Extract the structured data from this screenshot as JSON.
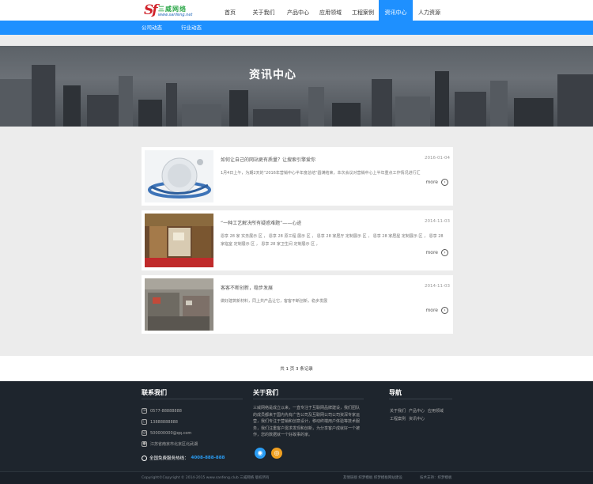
{
  "header": {
    "logo_text": "三威网络",
    "logo_mark": "Sf",
    "logo_url": "www.sanfeng.net",
    "nav": [
      "首页",
      "关于我们",
      "产品中心",
      "应用领域",
      "工程案例",
      "资讯中心",
      "人力资源"
    ],
    "active_index": 5
  },
  "subnav": [
    "公司动态",
    "行业动态"
  ],
  "banner": {
    "title": "资讯中心"
  },
  "news": [
    {
      "title": "如何让自己的网站更有质量？让搜索引擎爱你",
      "date": "2016-01-04",
      "desc": "1月4日上午，为期2天的“2016年营销中心半年度总结”圆满结束，本次会议对营销中心上半年重点工作情况进行汇",
      "more": "more"
    },
    {
      "title": "“一种工艺解决所有疑惑难题”——心迹",
      "date": "2014-11-03",
      "desc": "恩享 28 家 实务展示 区 ， 恩享 28 原工程 展示 区 ， 恩享 28 家居厅 定制展示 区 ， 恩享 28 家居屋 定制展示 区 ， 恩享 28 家临室 定制展示 区 ， 恩享 28 家卫生间 定制展示 区 ，",
      "more": "more"
    },
    {
      "title": "客客不断创新，稳步发展",
      "date": "2014-11-03",
      "desc": "做好建筑新材料，同上共产品让它，客客不断创新，稳步发展",
      "more": "more"
    }
  ],
  "pager": "共 1 页 3 条记录",
  "footer": {
    "contact_title": "联系我们",
    "phone": "0577-88888888",
    "mobile": "13888888888",
    "email": "500000000@qq.com",
    "address": "江苏省南京市北京区北武湖",
    "hotline_label": "全国免费服务热线：",
    "hotline": "4008-888-888",
    "about_title": "关于我们",
    "about_text": "三威网络是成立以来，一直专注于互联网品牌建设，我们团队的成员都来于国内先有广告公司及互联网公司公司资深专家运营，我们专注于营销和创意设计，移动终端用户体验等技术服务，我们注重客户需求发现和创新，为分享客户成就好一个被作，您的数据就一个好故事的家。",
    "social": [
      "qq",
      "weibo"
    ],
    "nav_title": "导航",
    "nav_links_1": [
      "关于我们",
      "产品中心",
      "应用领域"
    ],
    "nav_links_2": [
      "工程案例",
      "资讯中心"
    ],
    "copyright": "Copyright©Copyright © 2014-2015 www.sanfeng.club 三威网络 版权所有",
    "links_mid": "友情链接 织梦模板 织梦模板网站建设",
    "support": "技术支持：织梦模板"
  },
  "colors": {
    "accent": "#1e90ff",
    "footer_bg": "#1e252d",
    "hotline": "#2a9df4"
  }
}
